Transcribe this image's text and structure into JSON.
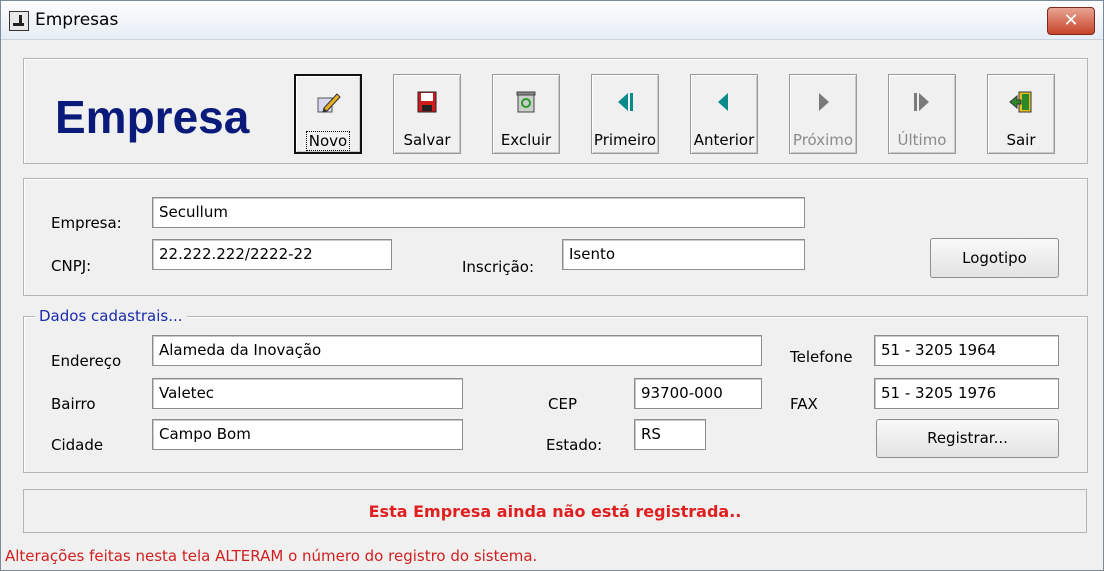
{
  "window": {
    "title": "Empresas",
    "close_label": "✕"
  },
  "header": {
    "title": "Empresa"
  },
  "toolbar": [
    {
      "label": "Novo",
      "icon": "edit-pencil-icon",
      "state": "selected"
    },
    {
      "label": "Salvar",
      "icon": "floppy-disk-icon",
      "state": "enabled"
    },
    {
      "label": "Excluir",
      "icon": "recycle-bin-icon",
      "state": "enabled"
    },
    {
      "label": "Primeiro",
      "icon": "first-record-icon",
      "state": "enabled"
    },
    {
      "label": "Anterior",
      "icon": "previous-record-icon",
      "state": "enabled"
    },
    {
      "label": "Próximo",
      "icon": "next-record-icon",
      "state": "disabled"
    },
    {
      "label": "Último",
      "icon": "last-record-icon",
      "state": "disabled"
    },
    {
      "label": "Sair",
      "icon": "exit-door-icon",
      "state": "enabled"
    }
  ],
  "company": {
    "empresa_label": "Empresa:",
    "empresa_value": "Secullum",
    "cnpj_label": "CNPJ:",
    "cnpj_value": "22.222.222/2222-22",
    "inscricao_label": "Inscrição:",
    "inscricao_value": "Isento",
    "logotipo_button": "Logotipo"
  },
  "dados": {
    "legend": "Dados cadastrais...",
    "endereco_label": "Endereço",
    "endereco_value": "Alameda da Inovação",
    "bairro_label": "Bairro",
    "bairro_value": "Valetec",
    "cidade_label": "Cidade",
    "cidade_value": "Campo Bom",
    "cep_label": "CEP",
    "cep_value": "93700-000",
    "estado_label": "Estado:",
    "estado_value": "RS",
    "telefone_label": "Telefone",
    "telefone_value": "51 - 3205 1964",
    "fax_label": "FAX",
    "fax_value": "51 - 3205 1976",
    "registrar_button": "Registrar..."
  },
  "status": {
    "message": "Esta Empresa ainda não está registrada.."
  },
  "footer": {
    "warning": "Alterações feitas nesta tela ALTERAM o número do registro do sistema."
  },
  "colors": {
    "title_blue": "#0a1a7a",
    "legend_blue": "#1a2bb0",
    "alert_red": "#e02020"
  }
}
